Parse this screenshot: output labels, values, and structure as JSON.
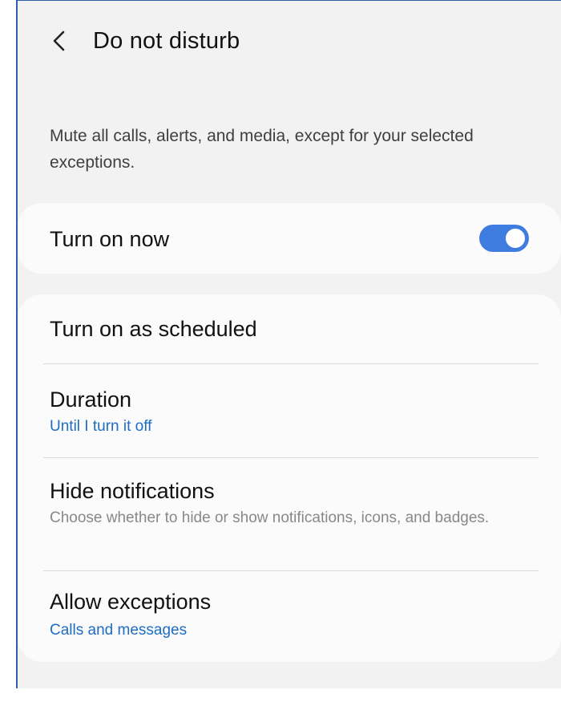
{
  "header": {
    "title": "Do not disturb",
    "back_icon": "chevron-left-icon"
  },
  "description": "Mute all calls, alerts, and media, except for your selected exceptions.",
  "turn_on_now": {
    "label": "Turn on now",
    "enabled": true,
    "accent_color": "#3e7ce0"
  },
  "settings": {
    "scheduled": {
      "label": "Turn on as scheduled"
    },
    "duration": {
      "label": "Duration",
      "value": "Until I turn it off"
    },
    "hide_notifications": {
      "label": "Hide notifications",
      "description": "Choose whether to hide or show notifications, icons, and badges."
    },
    "allow_exceptions": {
      "label": "Allow exceptions",
      "value": "Calls and messages"
    }
  },
  "colors": {
    "link": "#1e6cc3",
    "background": "#f2f2f2",
    "card": "#fbfbfb"
  }
}
